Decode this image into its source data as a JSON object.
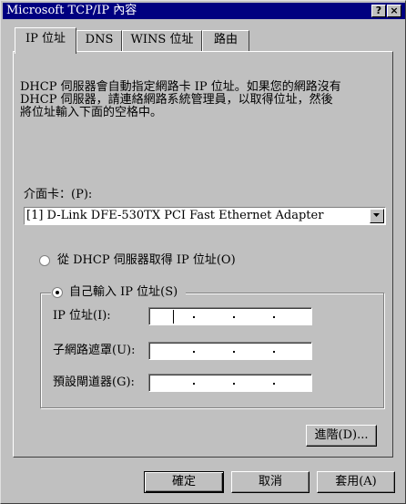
{
  "window": {
    "title": "Microsoft TCP/IP 內容",
    "help_button": "?",
    "close_button": "×"
  },
  "tabs": [
    {
      "label": "IP 位址",
      "active": true
    },
    {
      "label": "DNS",
      "active": false
    },
    {
      "label": "WINS 位址",
      "active": false
    },
    {
      "label": "路由",
      "active": false
    }
  ],
  "description": "DHCP 伺服器會自動指定網路卡 IP 位址。如果您的網路沒有\nDHCP 伺服器，請連絡網路系統管理員，以取得位址，然後\n將位址輸入下面的空格中。",
  "adapter": {
    "label": "介面卡：(P):",
    "selected": "[1] D-Link DFE-530TX PCI Fast Ethernet Adapter"
  },
  "radios": {
    "dhcp": {
      "label": "從 DHCP 伺服器取得 IP 位址(O)",
      "checked": false
    },
    "manual": {
      "label": "自己輸入 IP 位址(S)",
      "checked": true
    }
  },
  "fields": {
    "ip_label": "IP 位址(I):",
    "subnet_label": "子網路遮罩(U):",
    "gateway_label": "預設閘道器(G):"
  },
  "buttons": {
    "advanced": "進階(D)...",
    "ok": "確定",
    "cancel": "取消",
    "apply": "套用(A)"
  },
  "colors": {
    "title_bar": "#000080",
    "face": "#c0c0c0"
  }
}
